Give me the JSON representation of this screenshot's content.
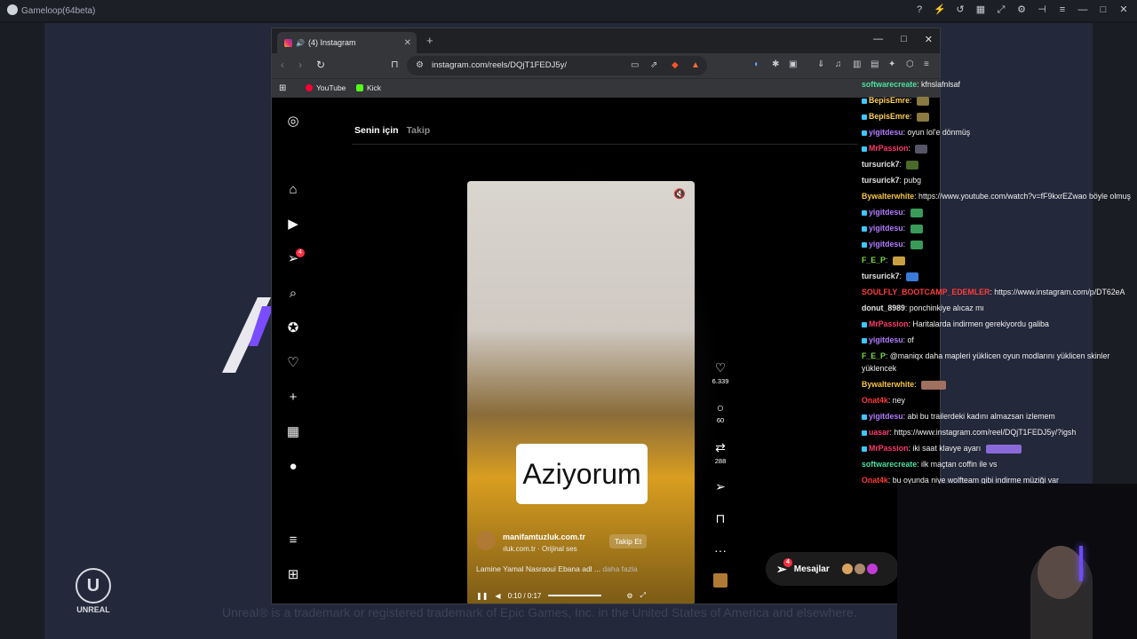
{
  "gameloop": {
    "title": "Gameloop(64beta)"
  },
  "unreal": {
    "logo_text": "UNREAL",
    "footer": "Unreal® is a trademark or registered trademark of Epic Games, Inc. in the United States of America and elsewhere."
  },
  "browser": {
    "tab_title": "(4) Instagram",
    "url": "instagram.com/reels/DQjT1FEDJ5y/",
    "bookmarks": [
      "YouTube",
      "Kick"
    ]
  },
  "instagram": {
    "tabs": [
      "Senin için",
      "Takip"
    ],
    "notification_count": "4",
    "reel": {
      "caption": "Aziyorum",
      "username": "manifamtuzluk.com.tr",
      "sound": "ıluk.com.tr · Orijinal ses",
      "follow_label": "Takip Et",
      "description": "Lamine Yamal Nasraoui Ebana adl ...",
      "more_label": "daha fazla",
      "time": "0:10 / 0:17"
    },
    "actions": {
      "likes": "6.339",
      "comments": "60",
      "reposts": "288"
    },
    "messages_label": "Mesajlar",
    "messages_badge": "4"
  },
  "chat": [
    {
      "user": "softwarecreate",
      "color": "#4be0a0",
      "msg": "kfnslafnlsaf"
    },
    {
      "user": "BepisEmre",
      "color": "#ffd05a",
      "msg": ""
    },
    {
      "user": "BepisEmre",
      "color": "#ffd05a",
      "msg": ""
    },
    {
      "user": "yigitdesu",
      "color": "#b07bff",
      "msg": "oyun lol'e dönmüş"
    },
    {
      "user": "MrPassion",
      "color": "#ff3b6b",
      "msg": ""
    },
    {
      "user": "tursurick7",
      "color": "#e0e0e0",
      "msg": ""
    },
    {
      "user": "tursurick7",
      "color": "#e0e0e0",
      "msg": "pubg"
    },
    {
      "user": "Bywalterwhite",
      "color": "#f5c542",
      "msg": "https://www.youtube.com/watch?v=fF9kxrEZwao böyle olmuş"
    },
    {
      "user": "yigitdesu",
      "color": "#b07bff",
      "msg": ""
    },
    {
      "user": "yigitdesu",
      "color": "#b07bff",
      "msg": ""
    },
    {
      "user": "yigitdesu",
      "color": "#b07bff",
      "msg": ""
    },
    {
      "user": "F_E_P",
      "color": "#7cd84a",
      "msg": ""
    },
    {
      "user": "tursurick7",
      "color": "#e0e0e0",
      "msg": ""
    },
    {
      "user": "SOULFLY_BOOTCAMP_EDEMLER",
      "color": "#ff3b3b",
      "msg": "https://www.instagram.com/p/DT62eA"
    },
    {
      "user": "donut_8989",
      "color": "#e0e0e0",
      "msg": "ponchinkiye alıcaz mı"
    },
    {
      "user": "MrPassion",
      "color": "#ff3b6b",
      "msg": "Haritalarda indirmen gerekiyordu galiba"
    },
    {
      "user": "yigitdesu",
      "color": "#b07bff",
      "msg": "of"
    },
    {
      "user": "F_E_P",
      "color": "#7cd84a",
      "msg": "@maniqx daha mapleri yüklicen oyun modlarını yüklicen skinler yüklencek"
    },
    {
      "user": "Bywalterwhite",
      "color": "#f5c542",
      "msg": ""
    },
    {
      "user": "Onat4k",
      "color": "#ff3b3b",
      "msg": "ney"
    },
    {
      "user": "yigitdesu",
      "color": "#b07bff",
      "msg": "abi bu trailerdeki kadını almazsan izlemem"
    },
    {
      "user": "uasar",
      "color": "#ff3b6b",
      "msg": "https://www.instagram.com/reel/DQjT1FEDJ5y/?igsh"
    },
    {
      "user": "MrPassion",
      "color": "#ff3b6b",
      "msg": "iki saat klavye ayarı"
    },
    {
      "user": "softwarecreate",
      "color": "#4be0a0",
      "msg": "ilk maçtan coffin ile vs"
    },
    {
      "user": "Onat4k",
      "color": "#ff3b3b",
      "msg": "bu oyunda niye wolfteam gibi indirme müziği var"
    }
  ]
}
